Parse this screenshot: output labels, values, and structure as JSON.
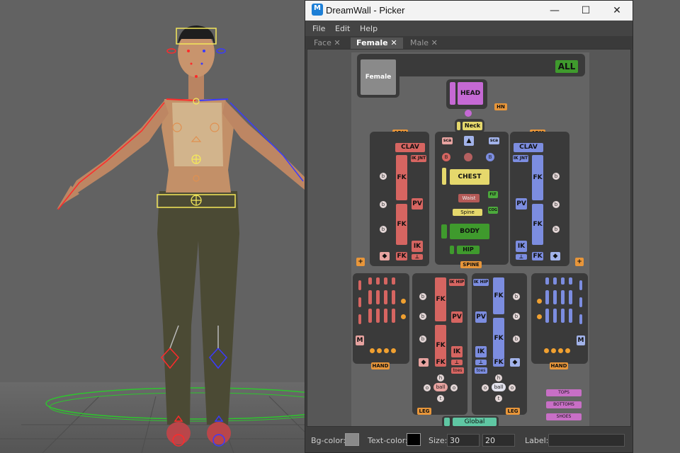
{
  "window": {
    "title": "DreamWall - Picker",
    "icon_letter": "M"
  },
  "window_controls": {
    "minimize": "—",
    "maximize": "☐",
    "close": "✕"
  },
  "menu": [
    "File",
    "Edit",
    "Help"
  ],
  "tabs": [
    {
      "label": "Face",
      "close": "✕"
    },
    {
      "label": "Female",
      "close": "✕"
    },
    {
      "label": "Male",
      "close": "✕"
    }
  ],
  "picker": {
    "thumb": "Female",
    "all": "ALL",
    "head": "HEAD",
    "hn": "HN",
    "neck": "Neck",
    "arm_left": "ARM",
    "arm_right": "ARM",
    "clav_left": "CLAV",
    "clav_right": "CLAV",
    "fk": "FK",
    "pv": "PV",
    "ik": "IK",
    "ik_jnt": "IK JNT",
    "sca": "sca",
    "chest": "CHEST",
    "waist": "Waist",
    "spine": "Spine",
    "body": "BODY",
    "hip": "HIP",
    "spine_label": "SPINE",
    "flt": "FLT",
    "cog": "COG",
    "b": "b",
    "B": "B",
    "plus": "+",
    "m": "M",
    "hand_left": "HAND",
    "hand_right": "HAND",
    "ik_hip": "IK HIP",
    "toes": "toes",
    "ball": "ball",
    "h": "h",
    "t": "t",
    "o": "o",
    "leg_left": "LEG",
    "leg_right": "LEG",
    "global": "Global",
    "tops": "TOPS",
    "bottoms": "BOTTOMS",
    "shoes": "SHOES"
  },
  "bottom": {
    "bg_label": "Bg-color:",
    "text_label": "Text-color:",
    "size_label": "Size:",
    "size_w": "30",
    "size_h": "20",
    "label_label": "Label:",
    "label_value": ""
  },
  "colors": {
    "bg": "#8a8a8a",
    "text": "#000000"
  }
}
